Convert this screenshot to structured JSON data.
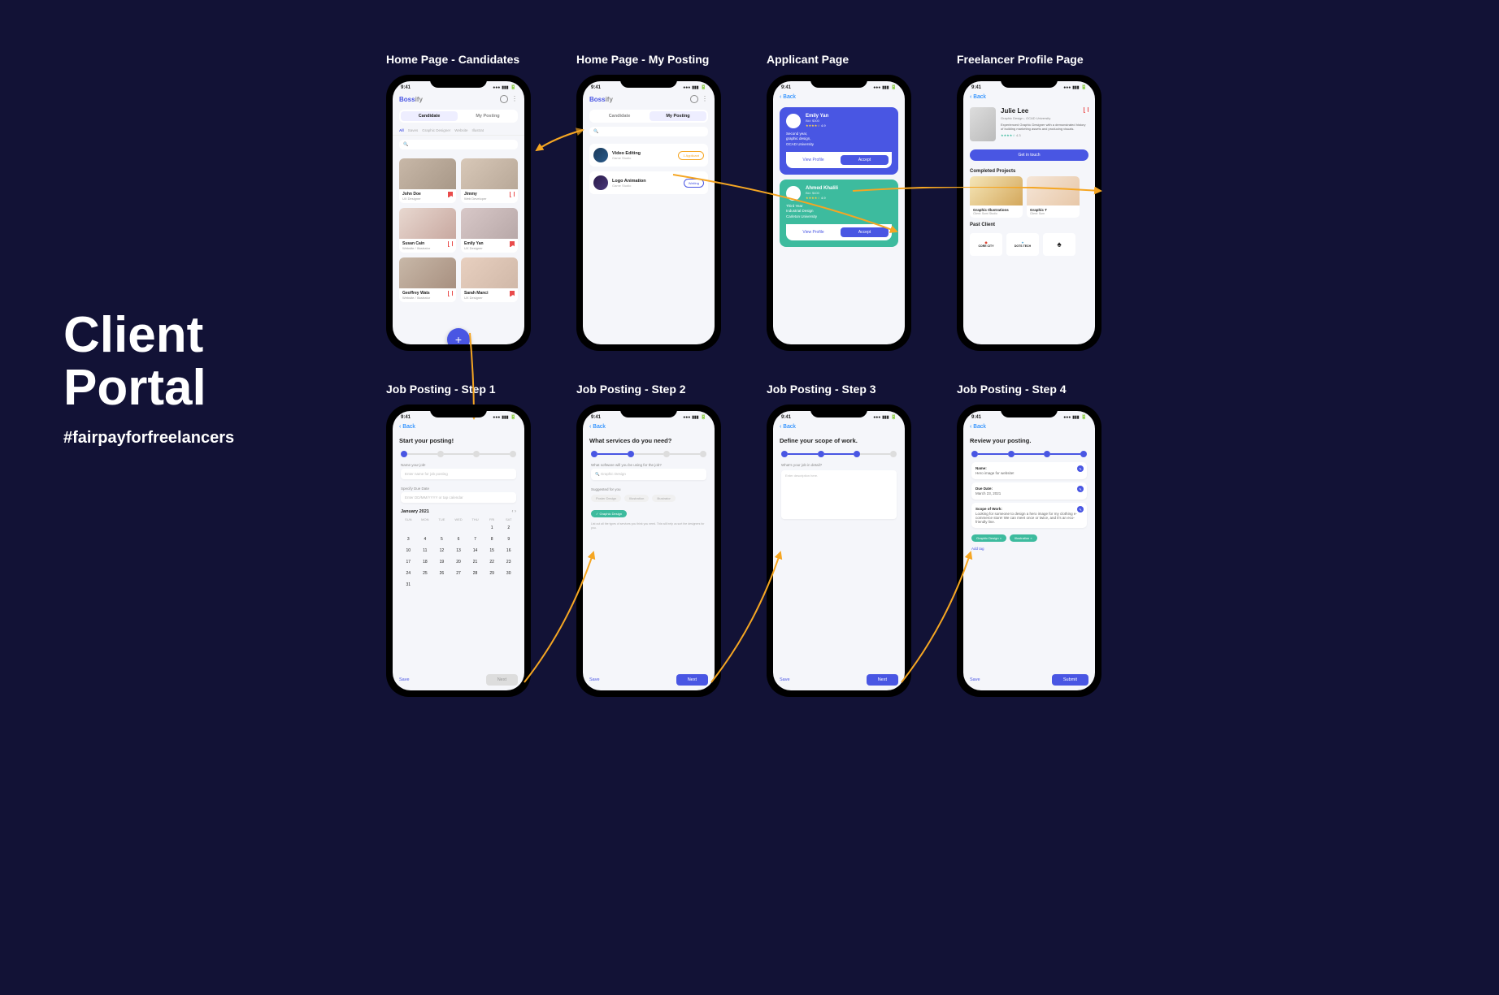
{
  "title": {
    "line1": "Client",
    "line2": "Portal"
  },
  "hashtag": "#fairpayforfreelancers",
  "time": "9:41",
  "labels": {
    "s1": "Home Page - Candidates",
    "s2": "Home Page - My Posting",
    "s3": "Applicant Page",
    "s4": "Freelancer Profile Page",
    "s5": "Job Posting - Step 1",
    "s6": "Job Posting - Step 2",
    "s7": "Job Posting - Step 3",
    "s8": "Job Posting - Step 4"
  },
  "brand": {
    "part1": "Boss",
    "part2": "ify"
  },
  "nav": {
    "back": "Back"
  },
  "tabs": {
    "candidate": "Candidate",
    "myposting": "My Posting"
  },
  "filters": [
    "All",
    "Saves",
    "Graphic Designer",
    "Website",
    "Illustrat"
  ],
  "candidates": [
    {
      "name": "John Doe",
      "role": "UX Designer"
    },
    {
      "name": "Jimmy",
      "role": "Web Developer"
    },
    {
      "name": "Susan Cain",
      "role": "Website / Illustrator"
    },
    {
      "name": "Emily Yan",
      "role": "UX Designer"
    },
    {
      "name": "Geoffrey Wats",
      "role": "Website / Illustrator"
    },
    {
      "name": "Sarah Manci",
      "role": "UX Designer"
    }
  ],
  "postings": [
    {
      "title": "Video Editing",
      "sub": "Game Studio",
      "badge": "1 Applicant",
      "badgeType": "orange"
    },
    {
      "title": "Logo Animation",
      "sub": "Game Studio",
      "badge": "Waiting",
      "badgeType": "purple"
    }
  ],
  "applicants": [
    {
      "name": "Emily Yan",
      "meta": "Bid: $300",
      "rating": "4.9",
      "desc": "Second year,\ngraphic design,\nOCAD University",
      "viewProfile": "View Profile",
      "accept": "Accept"
    },
    {
      "name": "Ahmed Khalili",
      "meta": "Bid: $400",
      "rating": "4.9",
      "desc": "Third Year\nIndustrial Design\nCarleton University",
      "viewProfile": "View Profile",
      "accept": "Accept"
    }
  ],
  "profile": {
    "name": "Julie Lee",
    "meta": "Graphic Design - OCAD University",
    "desc": "Experienced Graphic Designer with a demonstrated history of building marketing assets and producing visuals.",
    "rating": "4.3",
    "getInTouch": "Get in touch",
    "completedTitle": "Completed Projects",
    "projects": [
      {
        "title": "Graphic Illustrations",
        "client": "Client: Sumi Studio"
      },
      {
        "title": "Graphic T",
        "client": "Client: Sum"
      }
    ],
    "pastClientTitle": "Past Client",
    "clients": [
      "CORE CITY",
      "DOTS TECH",
      ""
    ]
  },
  "step1": {
    "title": "Start your posting!",
    "nameLabel": "Name your job!",
    "namePh": "Enter name for job posting",
    "dueLabel": "Specify Due Date",
    "duePh": "Enter DD/MM/YYYY or tap calendar",
    "month": "January 2021",
    "days": [
      "SUN",
      "MON",
      "TUE",
      "WED",
      "THU",
      "FRI",
      "SAT"
    ],
    "dates": [
      "",
      "",
      "",
      "",
      "",
      "1",
      "2",
      "3",
      "4",
      "5",
      "6",
      "7",
      "8",
      "9",
      "10",
      "11",
      "12",
      "13",
      "14",
      "15",
      "16",
      "17",
      "18",
      "19",
      "20",
      "21",
      "22",
      "23",
      "24",
      "25",
      "26",
      "27",
      "28",
      "29",
      "30",
      "31"
    ],
    "save": "Save",
    "next": "Next"
  },
  "step2": {
    "title": "What services do you need?",
    "q1": "What software will you be using for the job?",
    "ph": "Graphic Design",
    "suggested": "Suggested for you",
    "chips": [
      "Poster Design",
      "Illustration",
      "Illustrator"
    ],
    "selected": "Graphic Design",
    "hint": "List out all the types of services you think you need. This will help us sort the designers for you.",
    "save": "Save",
    "next": "Next"
  },
  "step3": {
    "title": "Define your scope of work.",
    "q1": "What's your job in detail?",
    "ph": "Enter description here.",
    "save": "Save",
    "next": "Next"
  },
  "step4": {
    "title": "Review your posting.",
    "name": {
      "label": "Name:",
      "val": "Hero image for website!"
    },
    "due": {
      "label": "Due Date:",
      "val": "March 23, 2021"
    },
    "scope": {
      "label": "Scope of Work:",
      "val": "Looking for someone to design a hero image for my clothing e-commerce store! We can meet once or twice, and it's an eco-friendly line."
    },
    "tags": [
      "Graphic Design",
      "Illustration"
    ],
    "addTag": "Add tag",
    "save": "Save",
    "submit": "Submit"
  }
}
